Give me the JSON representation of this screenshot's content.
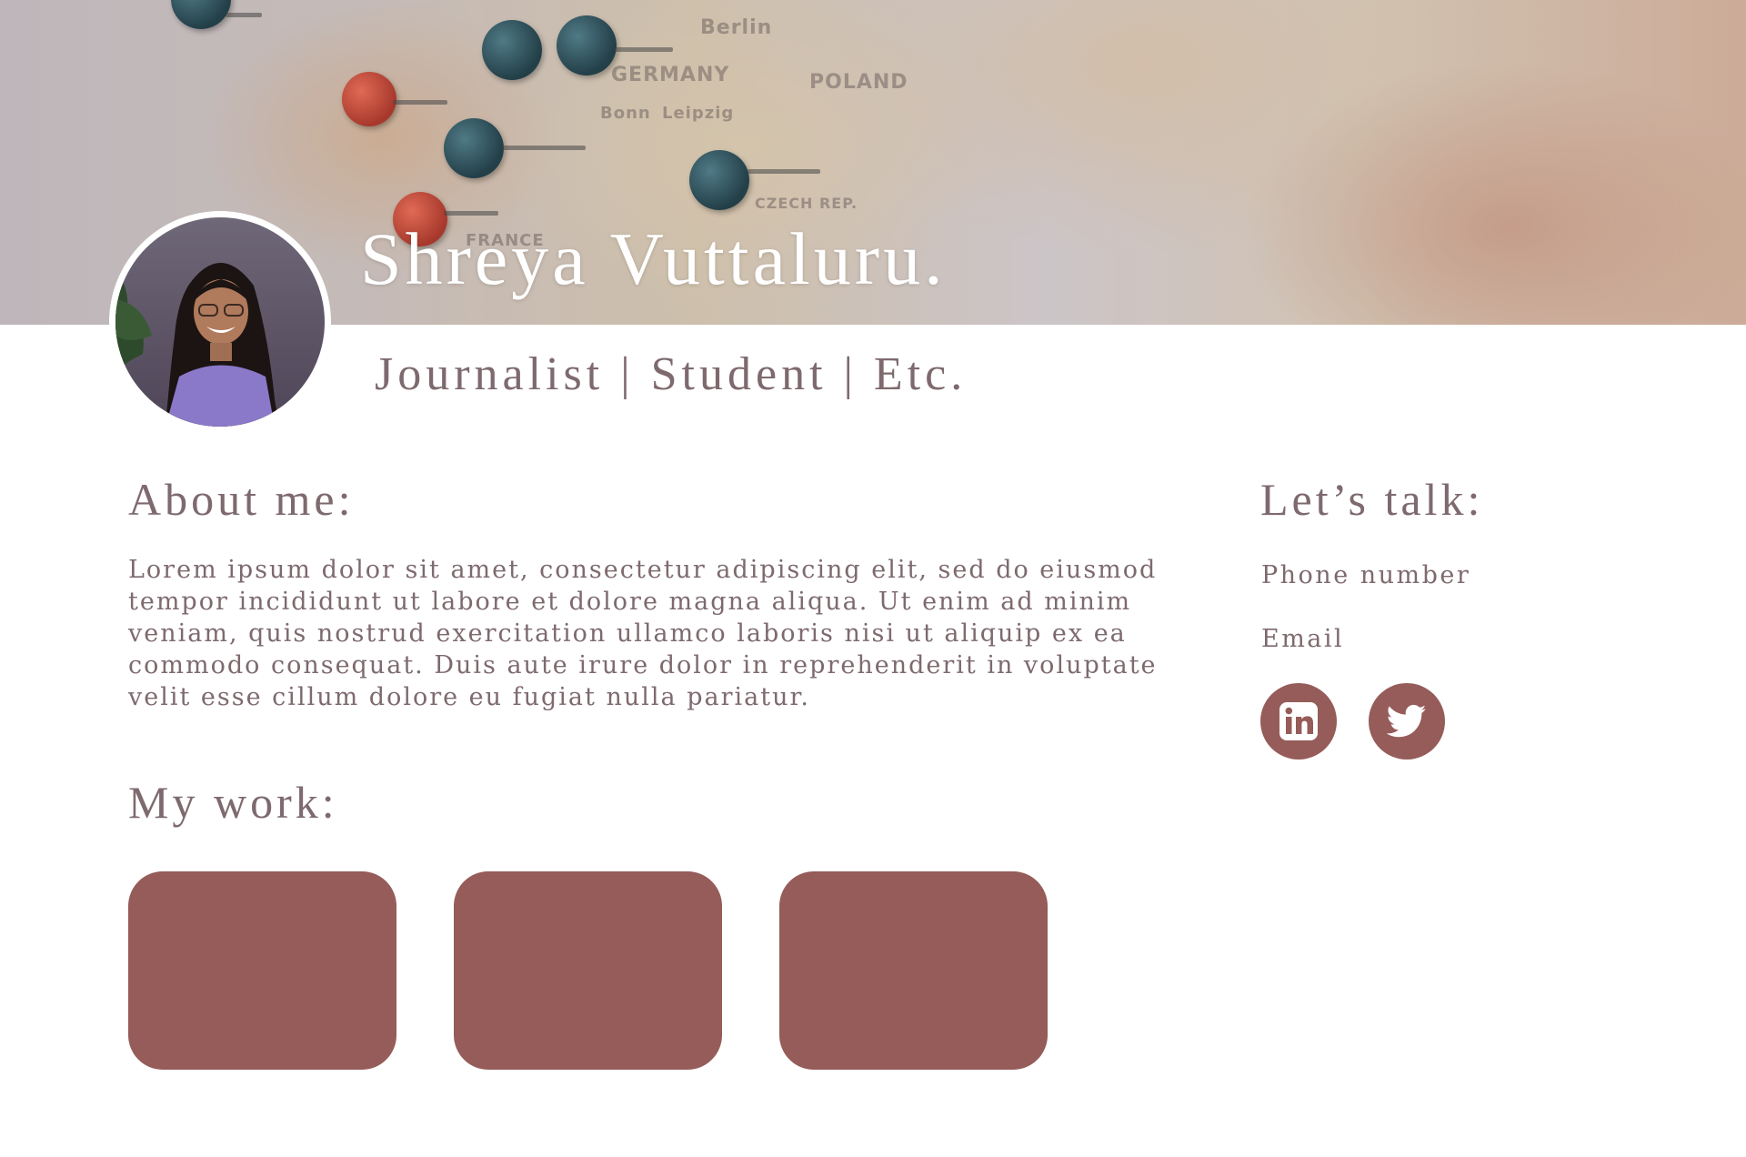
{
  "profile": {
    "name": "Shreya Vuttaluru.",
    "tagline": "Journalist | Student | Etc."
  },
  "banner": {
    "map_labels": [
      "Berlin",
      "GERMANY",
      "POLAND",
      "Bonn",
      "Leipzig",
      "FRANCE",
      "CZECH REP."
    ]
  },
  "about": {
    "heading": "About me:",
    "text": "Lorem ipsum dolor sit amet, consectetur adipiscing elit, sed do eiusmod tempor incididunt ut labore et dolore magna aliqua. Ut enim ad minim veniam, quis nostrud exercitation ullamco laboris nisi ut aliquip ex ea commodo consequat. Duis aute irure dolor in reprehenderit in voluptate velit esse cillum dolore eu fugiat nulla pariatur."
  },
  "work": {
    "heading": "My work:",
    "cards": [
      "work-card-1",
      "work-card-2",
      "work-card-3"
    ]
  },
  "contact": {
    "heading": "Let’s talk:",
    "phone_label": "Phone number",
    "email_label": "Email",
    "social": [
      {
        "icon": "linkedin-icon"
      },
      {
        "icon": "twitter-icon"
      }
    ]
  },
  "colors": {
    "accent": "#955c59",
    "text": "#7e6a6e",
    "background": "#ffffff"
  }
}
